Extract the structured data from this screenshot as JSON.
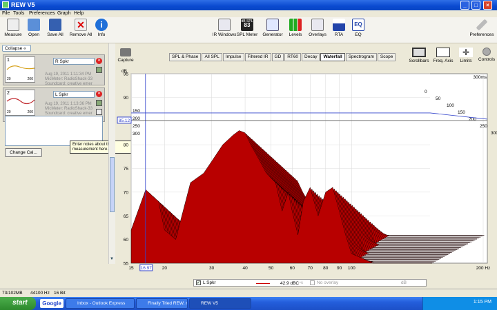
{
  "window": {
    "title": "REW V5"
  },
  "menu": [
    "File",
    "Tools",
    "Preferences",
    "Graph",
    "Help"
  ],
  "toolbar": {
    "left": [
      {
        "label": "Measure",
        "icon": "measure-icon"
      },
      {
        "label": "Open",
        "icon": "folder-icon"
      },
      {
        "label": "Save All",
        "icon": "save-icon"
      },
      {
        "label": "Remove All",
        "icon": "remove-icon"
      },
      {
        "label": "Info",
        "icon": "info-icon"
      }
    ],
    "right": [
      {
        "label": "IR Windows",
        "icon": "ir-windows-icon"
      },
      {
        "label": "SPL Meter",
        "icon": "spl-meter-icon",
        "badge_top": "dB SPL",
        "badge_value": "83"
      },
      {
        "label": "Generator",
        "icon": "generator-icon"
      },
      {
        "label": "Levels",
        "icon": "levels-icon"
      },
      {
        "label": "Overlays",
        "icon": "overlays-icon"
      },
      {
        "label": "RTA",
        "icon": "rta-icon"
      },
      {
        "label": "EQ",
        "icon": "eq-icon",
        "badge_value": "EQ"
      }
    ],
    "preferences": "Preferences"
  },
  "left_panel": {
    "collapse_label": "Collapse",
    "measurements": [
      {
        "index": "1",
        "name": "R Spkr",
        "date": "Aug 19, 2011 1:11:34 PM",
        "mic": "MicMeter: RadioShack-33",
        "soundcard": "Soundcard: creative emer",
        "thumb_x0": "20",
        "thumb_x1": "200",
        "color": "#d6a11a"
      },
      {
        "index": "2",
        "name": "L Spkr",
        "date": "Aug 19, 2011 1:13:36 PM",
        "mic": "MicMeter: RadioShack-33",
        "soundcard": "Soundcard: creative emer",
        "thumb_x0": "20",
        "thumb_x1": "200",
        "color": "#c0282d"
      }
    ],
    "change_cal": "Change Cal...",
    "tooltip": "Enter notes about the measurement here."
  },
  "capture_label": "Capture",
  "tabs": [
    {
      "label": "SPL & Phase",
      "active": false
    },
    {
      "label": "All SPL",
      "active": false
    },
    {
      "label": "Impulse",
      "active": false
    },
    {
      "label": "Filtered IR",
      "active": false
    },
    {
      "label": "GD",
      "active": false
    },
    {
      "label": "RT60",
      "active": false
    },
    {
      "label": "Decay",
      "active": false
    },
    {
      "label": "Waterfall",
      "active": true
    },
    {
      "label": "Spectrogram",
      "active": false
    },
    {
      "label": "Scope",
      "active": false
    }
  ],
  "right_tools": [
    {
      "label": "Scrollbars",
      "icon": "scrollbars-icon"
    },
    {
      "label": "Freq. Axis",
      "icon": "freq-axis-icon"
    },
    {
      "label": "Limits",
      "icon": "limits-icon"
    },
    {
      "label": "Controls",
      "icon": "controls-icon"
    }
  ],
  "chart_data": {
    "type": "area",
    "subtype": "waterfall",
    "ylabel": "dB",
    "y_unit": "dB",
    "yticks": [
      "95",
      "90",
      "85",
      "80",
      "75",
      "70",
      "65",
      "60",
      "55"
    ],
    "ylim": [
      55,
      95
    ],
    "xticks": [
      "15",
      "20",
      "30",
      "40",
      "50",
      "60",
      "70",
      "80",
      "90",
      "100",
      "200 Hz"
    ],
    "xlim_hz": [
      15,
      200
    ],
    "x_scale": "log",
    "time_axis_ms": [
      "0",
      "50",
      "100",
      "150",
      "200",
      "250",
      "300",
      "300ms"
    ],
    "cursor_freq": "16.97",
    "cursor_db": "85.12",
    "color": "#b80000",
    "slices": 30,
    "front_slice": {
      "freq_hz": [
        15,
        17,
        19,
        20,
        22,
        25,
        28,
        30,
        33,
        36,
        38,
        40,
        42,
        45,
        48,
        52,
        55,
        58,
        60,
        63,
        66,
        70,
        75,
        80,
        85,
        90,
        95,
        100,
        110,
        120,
        150,
        200
      ],
      "db": [
        62,
        70.5,
        68,
        62,
        60,
        72,
        74,
        76.5,
        80,
        82,
        83,
        82.5,
        80,
        77,
        74,
        72,
        66,
        70,
        66,
        61,
        68,
        71,
        65,
        70,
        71,
        66,
        61,
        57,
        56,
        55,
        55,
        55
      ]
    }
  },
  "legend": {
    "series_name": "L Spkr",
    "series_value": "42.9 dBC⁻¹",
    "overlay_label": "No overlay",
    "overlay_value": "dB"
  },
  "status": {
    "memory": "73/102MB",
    "rate": "44100 Hz",
    "bits": "16 Bit"
  },
  "taskbar": {
    "start": "start",
    "google": "Google",
    "tasks": [
      {
        "label": "Inbox - Outlook Express",
        "active": false
      },
      {
        "label": "Finally Tried REW, ne...",
        "active": false
      },
      {
        "label": "REW V5",
        "active": true
      }
    ],
    "clock": "1:15 PM"
  }
}
